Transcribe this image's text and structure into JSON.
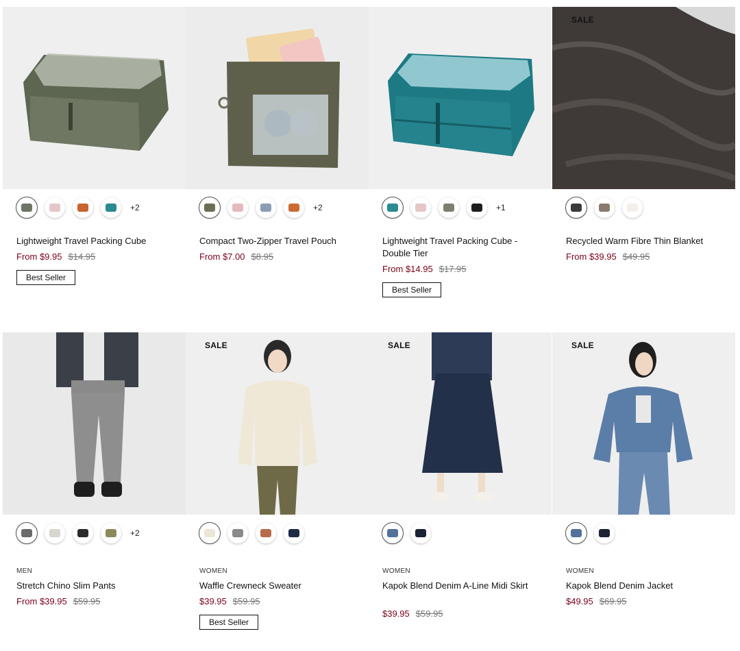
{
  "products": [
    {
      "sale_label": "",
      "category": "",
      "name": "Lightweight Travel Packing Cube",
      "price_prefix": "From ",
      "price": "$9.95",
      "original_price": "$14.95",
      "badge": "Best Seller",
      "more_colors": "+2",
      "swatches": [
        "#6e7566",
        "#e6c6c8",
        "#c8622f",
        "#2c8a93"
      ]
    },
    {
      "sale_label": "",
      "category": "",
      "name": "Compact Two-Zipper Travel Pouch",
      "price_prefix": "From ",
      "price": "$7.00",
      "original_price": "$8.95",
      "badge": "",
      "more_colors": "+2",
      "swatches": [
        "#6d6d55",
        "#e6b9be",
        "#8b9db2",
        "#cc6a34"
      ]
    },
    {
      "sale_label": "",
      "category": "",
      "name": "Lightweight Travel Packing Cube - Double Tier",
      "price_prefix": "From ",
      "price": "$14.95",
      "original_price": "$17.95",
      "badge": "Best Seller",
      "more_colors": "+1",
      "swatches": [
        "#2c8a93",
        "#e6c6c8",
        "#7b8070",
        "#1e1e1e"
      ]
    },
    {
      "sale_label": "SALE",
      "category": "",
      "name": "Recycled Warm Fibre Thin Blanket",
      "price_prefix": "From ",
      "price": "$39.95",
      "original_price": "$49.95",
      "badge": "",
      "more_colors": "",
      "swatches": [
        "#3e3a38",
        "#8b7a6c",
        "#f4efec"
      ]
    },
    {
      "sale_label": "",
      "category": "MEN",
      "name": "Stretch Chino Slim Pants",
      "price_prefix": "From ",
      "price": "$39.95",
      "original_price": "$59.95",
      "badge": "",
      "more_colors": "+2",
      "swatches": [
        "#6a6a6a",
        "#d9d6cf",
        "#2b2b2b",
        "#8c8a5a"
      ]
    },
    {
      "sale_label": "SALE",
      "category": "WOMEN",
      "name": "Waffle Crewneck Sweater",
      "price_prefix": "",
      "price": "$39.95",
      "original_price": "$59.95",
      "badge": "Best Seller",
      "more_colors": "",
      "swatches": [
        "#ece6d5",
        "#8a8a8a",
        "#b86b4b",
        "#1f2a44"
      ]
    },
    {
      "sale_label": "SALE",
      "category": "WOMEN",
      "name": "Kapok Blend Denim A-Line Midi Skirt",
      "price_prefix": "",
      "price": "$39.95",
      "original_price": "$59.95",
      "badge": "",
      "more_colors": "",
      "swatches": [
        "#55709a",
        "#1c2334"
      ]
    },
    {
      "sale_label": "SALE",
      "category": "WOMEN",
      "name": "Kapok Blend Denim Jacket",
      "price_prefix": "",
      "price": "$49.95",
      "original_price": "$69.95",
      "badge": "",
      "more_colors": "",
      "swatches": [
        "#55709a",
        "#1c2334"
      ]
    }
  ],
  "colors": {
    "sale_price": "#7a0019",
    "strike_price": "#777777"
  }
}
